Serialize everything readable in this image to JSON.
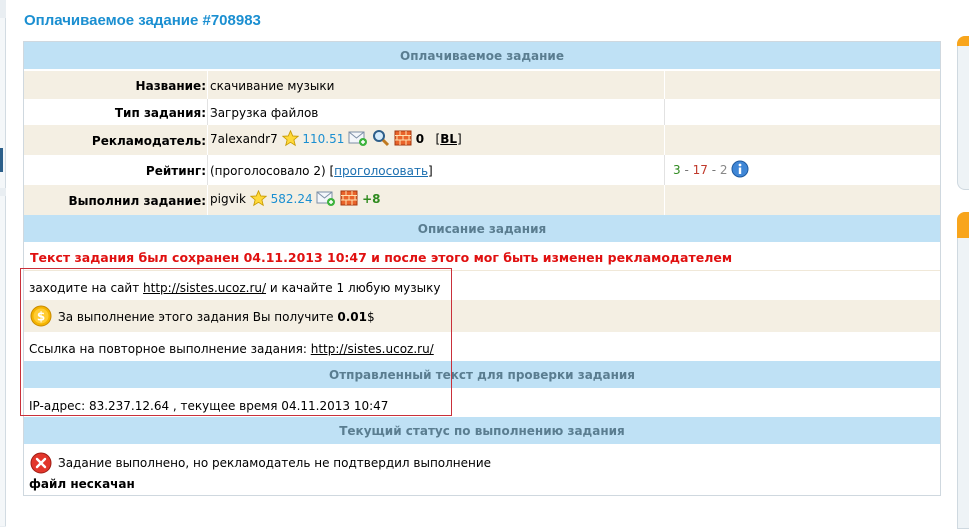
{
  "page": {
    "title": "Оплачиваемое задание #708983"
  },
  "task": {
    "section_title": "Оплачиваемое задание",
    "name_label": "Название:",
    "name_value": "скачивание музыки",
    "type_label": "Тип задания:",
    "type_value": "Загрузка файлов",
    "advertiser_label": "Рекламодатель:",
    "advertiser_name": "7alexandr7",
    "advertiser_rating": "110.51",
    "advertiser_count": "0",
    "advertiser_bl": "BL",
    "bl_open": "[",
    "bl_close": "]",
    "rating_label": "Рейтинг:",
    "rating_text": "(проголосовало 2) [",
    "rating_vote_link": "проголосовать",
    "rating_close": "]",
    "rating_pos": "3",
    "rating_sep1": " - ",
    "rating_neutral": "17",
    "rating_sep2": " - ",
    "rating_neg": "2",
    "performer_label": "Выполнил задание:",
    "performer_name": "pigvik",
    "performer_rating": "582.24",
    "performer_count": "+8"
  },
  "description": {
    "section_title": "Описание задания",
    "warning": "Текст задания был сохранен 04.11.2013 10:47 и после этого мог быть изменен рекламодателем",
    "line1_pre": "заходите на сайт ",
    "line1_link": "http://sistes.ucoz.ru/",
    "line1_post": " и качайте 1 любую музыку",
    "reward_pre": "За выполнение этого задания Вы получите ",
    "reward_amount": "0.01",
    "reward_currency": "$",
    "repeat_pre": "Ссылка на повторное выполнение задания: ",
    "repeat_link": "http://sistes.ucoz.ru/"
  },
  "sent": {
    "section_title": "Отправленный текст для проверки задания",
    "text": "IP-адрес: 83.237.12.64 , текущее время 04.11.2013 10:47"
  },
  "status": {
    "section_title": "Текущий статус по выполнению задания",
    "text": "Задание выполнено, но рекламодатель не подтвердил выполнение",
    "note": "файл нескачан"
  },
  "colors": {
    "accent": "#1b8fd1",
    "section_bg": "#bfe1f5",
    "row_beige": "#f4efe3",
    "warning_red": "#e01010",
    "highlight_box": "#c9303a"
  }
}
